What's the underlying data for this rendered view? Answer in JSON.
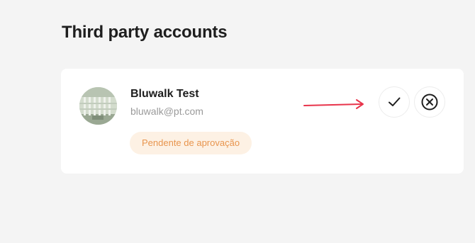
{
  "section": {
    "title": "Third party accounts"
  },
  "account": {
    "name": "Bluwalk Test",
    "email": "bluwalk@pt.com",
    "status": "Pendente de aprovação",
    "status_color": "#e8954e",
    "status_bg": "#fdf1e4"
  },
  "actions": {
    "approve_icon": "check-icon",
    "reject_icon": "close-circle-icon"
  },
  "annotation": {
    "arrow_color": "#e8344b"
  },
  "colors": {
    "background": "#f4f4f4",
    "card": "#ffffff",
    "title_text": "#1e1e1e",
    "secondary_text": "#9a9a9a"
  }
}
